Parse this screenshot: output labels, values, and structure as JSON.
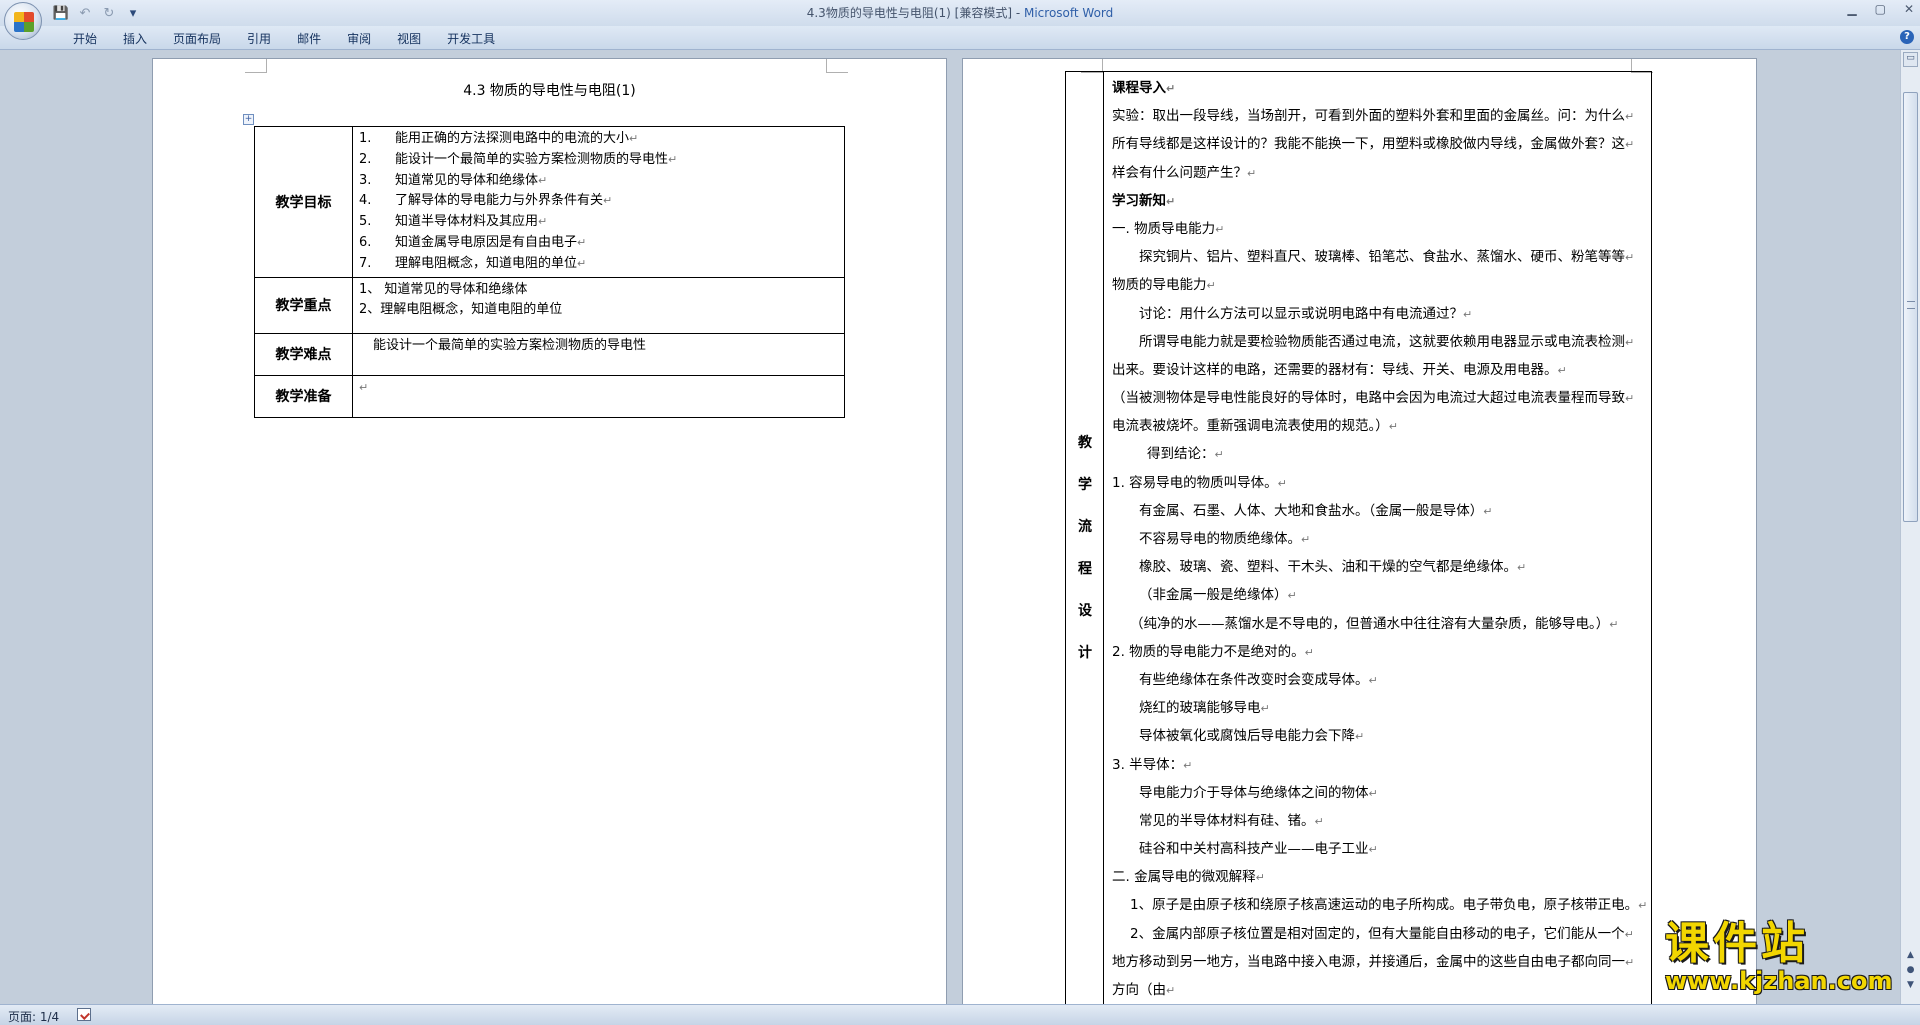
{
  "window": {
    "title": "4.3物质的导电性与电阻(1) [兼容模式]",
    "app_name": "Microsoft Word",
    "controls": [
      "▁",
      "▢",
      "✕"
    ]
  },
  "quick_access": {
    "save_icon": "💾",
    "undo_icon": "↶",
    "redo_icon": "↻",
    "more_icon": "▾"
  },
  "ribbon": {
    "tabs": [
      "开始",
      "插入",
      "页面布局",
      "引用",
      "邮件",
      "审阅",
      "视图",
      "开发工具"
    ],
    "help_label": "?"
  },
  "page1": {
    "title": "4.3 物质的导电性与电阻(1)",
    "pilcrow": "↵",
    "objectives_label": "教学目标",
    "objectives": [
      {
        "num": "1.",
        "text": "能用正确的方法探测电路中的电流的大小"
      },
      {
        "num": "2.",
        "text": "能设计一个最简单的实验方案检测物质的导电性"
      },
      {
        "num": "3.",
        "text": "知道常见的导体和绝缘体"
      },
      {
        "num": "4.",
        "text": "了解导体的导电能力与外界条件有关"
      },
      {
        "num": "5.",
        "text": "知道半导体材料及其应用"
      },
      {
        "num": "6.",
        "text": "知道金属导电原因是有自由电子"
      },
      {
        "num": "7.",
        "text": "理解电阻概念，知道电阻的单位"
      }
    ],
    "focus_label": "教学重点",
    "focus": [
      "1、 知道常见的导体和绝缘体",
      "2、理解电阻概念，知道电阻的单位"
    ],
    "difficulty_label": "教学难点",
    "difficulty": "能设计一个最简单的实验方案检测物质的导电性",
    "prep_label": "教学准备",
    "prep": ""
  },
  "page2": {
    "vertical_label": [
      "教",
      "学",
      "流",
      "程",
      "设",
      "计"
    ],
    "lines": [
      {
        "t": "课程导入",
        "cls": "b"
      },
      {
        "t": "实验：取出一段导线，当场剖开，可看到外面的塑料外套和里面的金属丝。问：为什么",
        "cls": ""
      },
      {
        "t": "所有导线都是这样设计的？我能不能换一下，用塑料或橡胶做内导线，金属做外套？这",
        "cls": ""
      },
      {
        "t": "样会有什么问题产生？",
        "cls": ""
      },
      {
        "t": "学习新知",
        "cls": "b"
      },
      {
        "t": "一. 物质导电能力",
        "cls": ""
      },
      {
        "t": "探究铜片、铝片、塑料直尺、玻璃棒、铅笔芯、食盐水、蒸馏水、硬币、粉笔等等",
        "cls": "i1"
      },
      {
        "t": "物质的导电能力",
        "cls": ""
      },
      {
        "t": "讨论：用什么方法可以显示或说明电路中有电流通过？",
        "cls": "i1"
      },
      {
        "t": "所谓导电能力就是要检验物质能否通过电流，这就要依赖用电器显示或电流表检测",
        "cls": "i1"
      },
      {
        "t": "出来。要设计这样的电路，还需要的器材有：导线、开关、电源及用电器。",
        "cls": ""
      },
      {
        "t": "（当被测物体是导电性能良好的导体时，电路中会因为电流过大超过电流表量程而导致",
        "cls": ""
      },
      {
        "t": "电流表被烧坏。重新强调电流表使用的规范。）",
        "cls": ""
      },
      {
        "t": "得到结论：",
        "cls": "i2"
      },
      {
        "t": "1. 容易导电的物质叫导体。",
        "cls": ""
      },
      {
        "t": "有金属、石墨、人体、大地和食盐水。（金属一般是导体）",
        "cls": "i1"
      },
      {
        "t": "不容易导电的物质绝缘体。",
        "cls": "i1"
      },
      {
        "t": "橡胶、玻璃、瓷、塑料、干木头、油和干燥的空气都是绝缘体。",
        "cls": "i1"
      },
      {
        "t": "（非金属一般是绝缘体）",
        "cls": "i1"
      },
      {
        "t": "（纯净的水——蒸馏水是不导电的，但普通水中往往溶有大量杂质，能够导电。）",
        "cls": "i0s"
      },
      {
        "t": "2. 物质的导电能力不是绝对的。",
        "cls": ""
      },
      {
        "t": "有些绝缘体在条件改变时会变成导体。",
        "cls": "i1"
      },
      {
        "t": "烧红的玻璃能够导电",
        "cls": "i1"
      },
      {
        "t": "导体被氧化或腐蚀后导电能力会下降",
        "cls": "i1"
      },
      {
        "t": "3. 半导体：",
        "cls": ""
      },
      {
        "t": "导电能力介于导体与绝缘体之间的物体",
        "cls": "i1"
      },
      {
        "t": "常见的半导体材料有硅、锗。",
        "cls": "i1"
      },
      {
        "t": "硅谷和中关村高科技产业——电子工业",
        "cls": "i1"
      },
      {
        "t": "二. 金属导电的微观解释",
        "cls": ""
      },
      {
        "t": "1、原子是由原子核和绕原子核高速运动的电子所构成。电子带负电，原子核带正电。",
        "cls": "i0s"
      },
      {
        "t": "2、金属内部原子核位置是相对固定的，但有大量能自由移动的电子，它们能从一个",
        "cls": "i0s"
      },
      {
        "t": "地方移动到另一地方，当电路中接入电源，并接通后，金属中的这些自由电子都向同一",
        "cls": ""
      },
      {
        "t": "方向（由",
        "cls": ""
      }
    ]
  },
  "statusbar": {
    "page_count": "页面: 1/4"
  },
  "watermark": {
    "cn": "课件站",
    "url": "www.kjzhan.com"
  }
}
